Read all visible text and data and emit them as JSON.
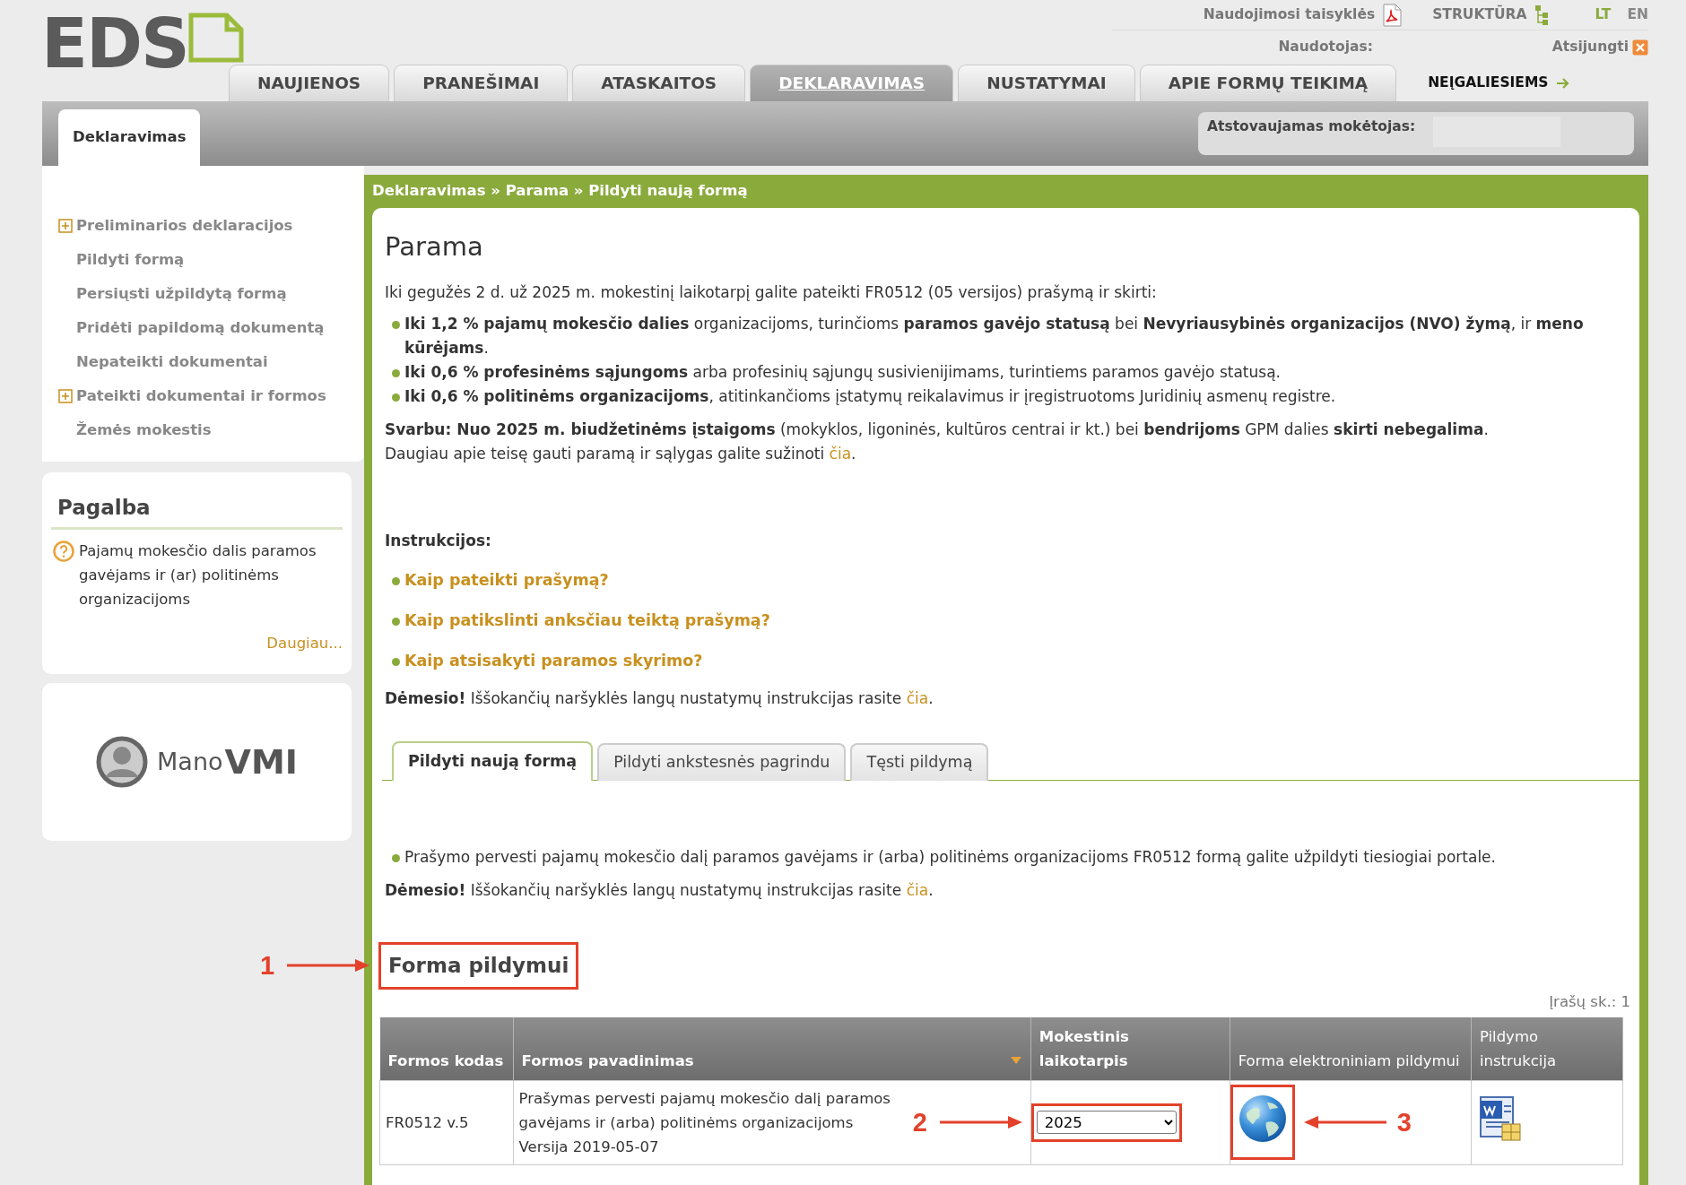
{
  "logo": {
    "text": "EDS"
  },
  "top_links": [
    {
      "label": "Naudojimosi taisyklės",
      "kind": "pdf"
    },
    {
      "label": "STRUKTŪRA",
      "kind": "tree"
    }
  ],
  "languages": [
    {
      "label": "LT",
      "selected": true
    },
    {
      "label": "EN",
      "selected": false
    }
  ],
  "user": {
    "label": "Naudotojas:",
    "logout": "Atsijungti"
  },
  "nav_tabs": [
    {
      "label": "NAUJIENOS",
      "selected": false
    },
    {
      "label": "PRANEŠIMAI",
      "selected": false
    },
    {
      "label": "ATASKAITOS",
      "selected": false
    },
    {
      "label": "DEKLARAVIMAS",
      "selected": true
    },
    {
      "label": "NUSTATYMAI",
      "selected": false
    },
    {
      "label": "APIE FORMŲ TEIKIMĄ",
      "selected": false
    }
  ],
  "accessibility_link": "NEĮGALIESIEMS",
  "sub_tabs": [
    {
      "label": "Deklaravimas",
      "selected": true
    }
  ],
  "represented_payer": {
    "label": "Atstovaujamas mokėtojas:"
  },
  "sidebar": {
    "items": [
      {
        "label": "Preliminarios deklaracijos",
        "expandable": true
      },
      {
        "label": "Pildyti formą",
        "expandable": false
      },
      {
        "label": "Persiųsti užpildytą formą",
        "expandable": false
      },
      {
        "label": "Pridėti papildomą dokumentą",
        "expandable": false
      },
      {
        "label": "Nepateikti dokumentai",
        "expandable": false
      },
      {
        "label": "Pateikti dokumentai ir formos",
        "expandable": true
      },
      {
        "label": "Žemės mokestis",
        "expandable": false
      }
    ]
  },
  "help": {
    "title": "Pagalba",
    "text": "Pajamų mokesčio dalis paramos gavėjams ir (ar) politinėms organizacijoms",
    "more": "Daugiau..."
  },
  "promo": {
    "brand_left": "Mano",
    "brand_right": "VMI"
  },
  "breadcrumb": "Deklaravimas » Parama » Pildyti naują formą",
  "content": {
    "title": "Parama",
    "intro": "Iki gegužės 2 d. už 2025 m. mokestinį laikotarpį galite pateikti FR0512 (05 versijos) prašymą ir skirti:",
    "bullets": [
      "**Iki 1,2 % pajamų mokesčio dalies** organizacijoms, turinčioms **paramos gavėjo statusą** bei **Nevyriausybinės organizacijos (NVO) žymą**, ir **meno kūrėjams**.",
      "**Iki 0,6 % profesinėms sąjungoms** arba profesinių sąjungų susivienijimams, turintiems paramos gavėjo statusą.",
      "**Iki 0,6 % politinėms organizacijoms**, atitinkančioms įstatymų reikalavimus ir įregistruotoms Juridinių asmenų registre."
    ],
    "important": "**Svarbu: Nuo 2025 m. biudžetinėms įstaigoms** (mokyklos, ligoninės, kultūros centrai ir kt.) bei **bendrijoms** GPM dalies **skirti nebegalima**.",
    "more_info": {
      "text": "Daugiau apie teisę gauti paramą ir sąlygas galite sužinoti",
      "link": "čia",
      "end": "."
    },
    "instructions": {
      "title": "Instrukcijos:",
      "links": [
        "Kaip pateikti prašymą?",
        "Kaip patikslinti anksčiau teiktą prašymą?",
        "Kaip atsisakyti paramos skyrimo?"
      ]
    },
    "notice": {
      "text": "**Dėmesio!** Iššokančių naršyklės langų nustatymų instrukcijas rasite",
      "link": "čia",
      "end": "."
    }
  },
  "form_tabs": [
    {
      "label": "Pildyti naują formą",
      "selected": true
    },
    {
      "label": "Pildyti ankstesnės pagrindu",
      "selected": false
    },
    {
      "label": "Tęsti pildymą",
      "selected": false
    }
  ],
  "tab_content": {
    "bullet": "Prašymo pervesti pajamų mokesčio dalį paramos gavėjams ir (arba) politinėms organizacijoms FR0512 formą galite užpildyti tiesiogiai portale.",
    "notice": {
      "text": "**Dėmesio!** Iššokančių naršyklės langų nustatymų instrukcijas rasite",
      "link": "čia",
      "end": "."
    }
  },
  "forms": {
    "title": "Forma pildymui",
    "title_marker": "1",
    "count": "Įrašų sk.: 1",
    "columns": [
      {
        "label": "Formos kodas",
        "bold": true,
        "sortable": false
      },
      {
        "label": "Formos pavadinimas",
        "bold": true,
        "sortable": true
      },
      {
        "label": "Mokestinis laikotarpis",
        "bold": true,
        "sortable": false
      },
      {
        "label": "Forma elektroniniam pildymui",
        "bold": false,
        "sortable": false
      },
      {
        "label": "Pildymo instrukcija",
        "bold": false,
        "sortable": false
      }
    ],
    "rows": [
      {
        "code": "FR0512 v.5",
        "name": "Prašymas pervesti pajamų mokesčio dalį paramos gavėjams ir (arba) politinėms organizacijoms",
        "version": "Versija 2019-05-07",
        "period": "2025",
        "period_marker": "2",
        "online_form_marker": "3"
      }
    ]
  }
}
